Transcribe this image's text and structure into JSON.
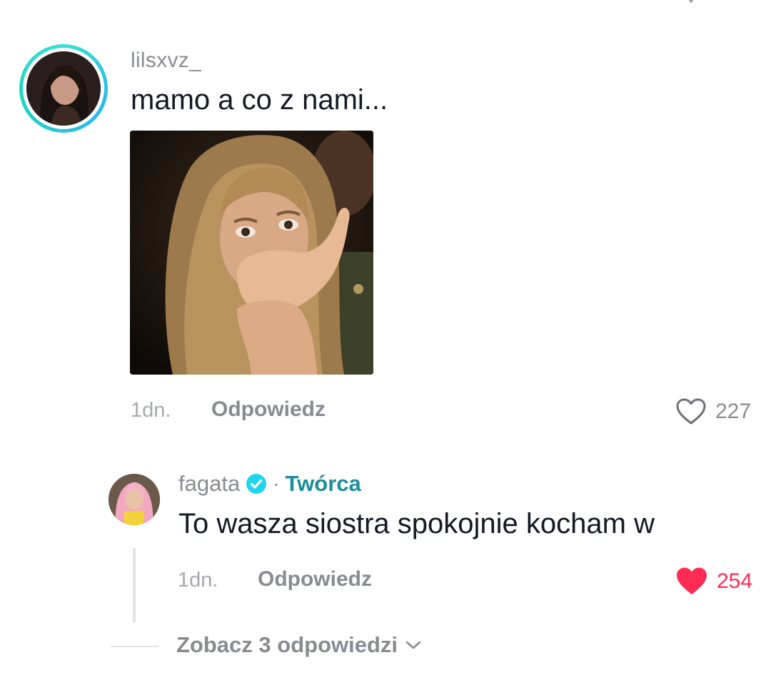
{
  "comment": {
    "username": "lilsxvz_",
    "text": "mamo a co z nami...",
    "time": "1dn.",
    "reply_label": "Odpowiedz",
    "likes": "227",
    "liked": false
  },
  "reply": {
    "username": "fagata",
    "verified": true,
    "separator": "·",
    "creator_label": "Twórca",
    "text": "To wasza siostra spokojnie kocham w",
    "time": "1dn.",
    "reply_label": "Odpowiedz",
    "likes": "254",
    "liked": true
  },
  "view_replies": {
    "label": "Zobacz 3 odpowiedzi",
    "icon": "chevron-down-icon"
  },
  "colors": {
    "liked_heart": "#fe2c55",
    "verified_badge": "#20d5ec",
    "creator_label": "#1a8e9b",
    "muted_text": "#8a8b91",
    "ring_gradient": "#2cd4d6"
  }
}
